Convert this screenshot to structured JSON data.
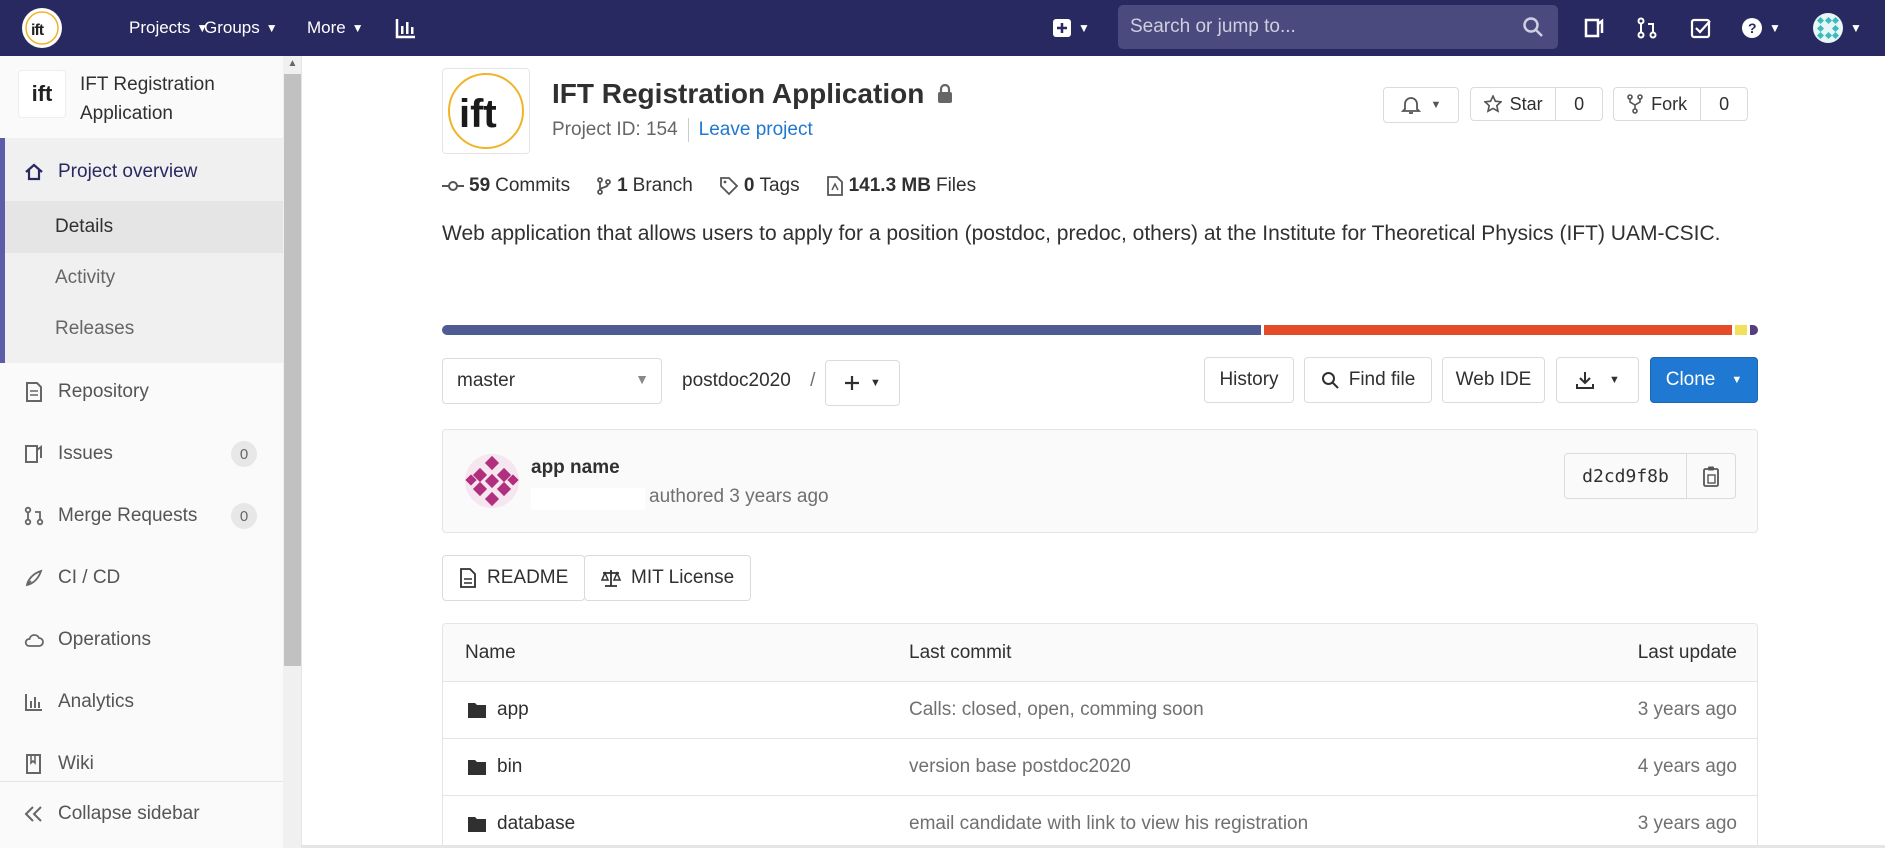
{
  "nav": {
    "projects": "Projects",
    "groups": "Groups",
    "more": "More",
    "search_placeholder": "Search or jump to..."
  },
  "sidebar": {
    "context_title": "IFT Registration Application",
    "overview": "Project overview",
    "sub_items": [
      "Details",
      "Activity",
      "Releases"
    ],
    "items": [
      {
        "label": "Repository"
      },
      {
        "label": "Issues",
        "count": "0"
      },
      {
        "label": "Merge Requests",
        "count": "0"
      },
      {
        "label": "CI / CD"
      },
      {
        "label": "Operations"
      },
      {
        "label": "Analytics"
      },
      {
        "label": "Wiki"
      }
    ],
    "collapse": "Collapse sidebar"
  },
  "project": {
    "name": "IFT Registration Application",
    "id_text": "Project ID: 154",
    "leave": "Leave project",
    "star_label": "Star",
    "star_count": "0",
    "fork_label": "Fork",
    "fork_count": "0",
    "commits_num": "59",
    "commits_label": "Commits",
    "branch_num": "1",
    "branch_label": "Branch",
    "tags_num": "0",
    "tags_label": "Tags",
    "files_num": "141.3 MB",
    "files_label": "Files",
    "description": "Web application that allows users to apply for a position (postdoc, predoc, others) at the Institute for Theoretical Physics (IFT) UAM-CSIC.",
    "language_colors": [
      "#4f5b93",
      "#e34c26",
      "#f1e05a",
      "#563d7c"
    ]
  },
  "toolbar": {
    "branch": "master",
    "path": "postdoc2020",
    "path_sep": "/",
    "history": "History",
    "find_file": "Find file",
    "web_ide": "Web IDE",
    "clone": "Clone"
  },
  "commit": {
    "title": "app name",
    "authored": "authored 3 years ago",
    "sha": "d2cd9f8b"
  },
  "badges": {
    "readme": "README",
    "license": "MIT License"
  },
  "files": {
    "headers": {
      "name": "Name",
      "last_commit": "Last commit",
      "last_update": "Last update"
    },
    "rows": [
      {
        "name": "app",
        "msg": "Calls: closed, open, comming soon",
        "date": "3 years ago"
      },
      {
        "name": "bin",
        "msg": "version base postdoc2020",
        "date": "4 years ago"
      },
      {
        "name": "database",
        "msg": "email candidate with link to view his registration",
        "date": "3 years ago"
      }
    ]
  }
}
